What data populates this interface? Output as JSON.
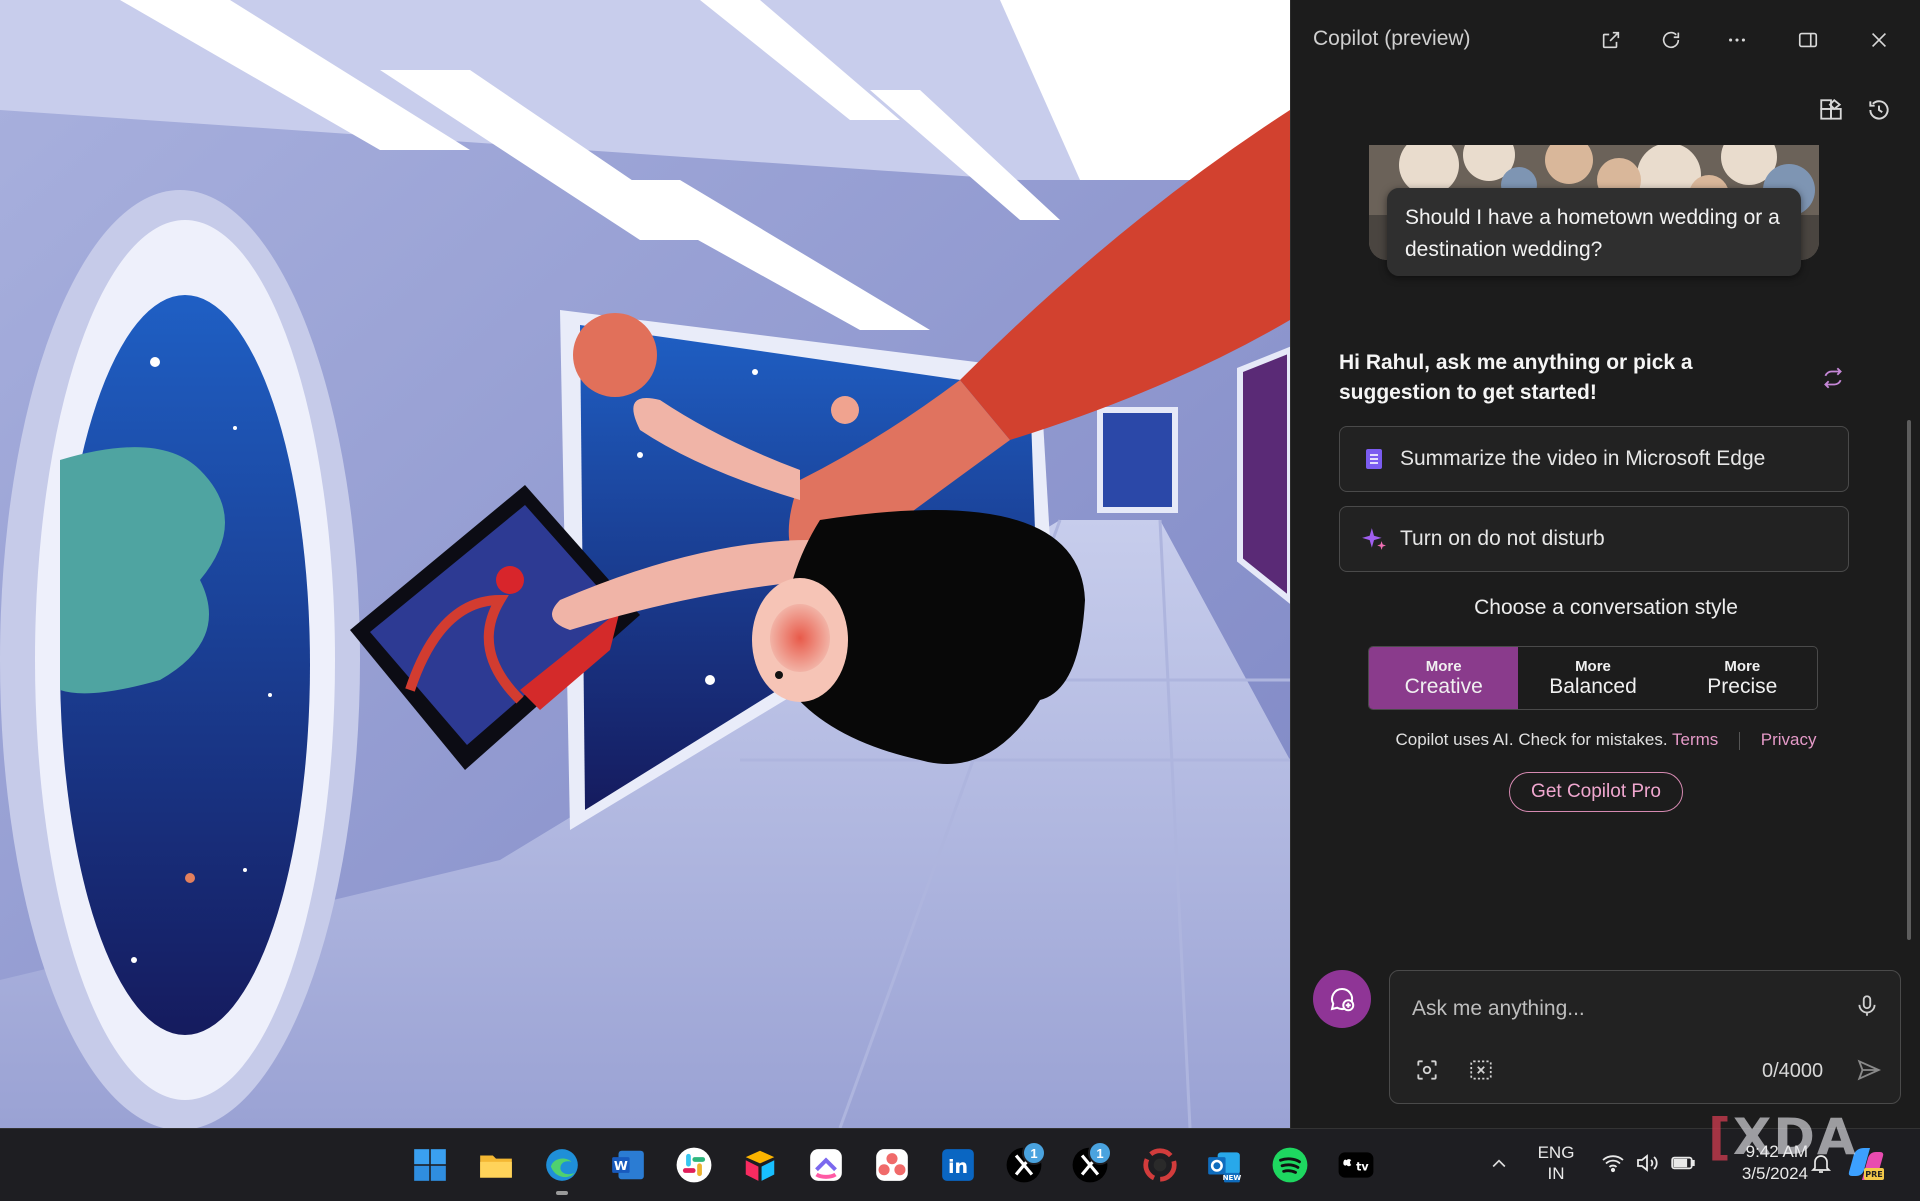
{
  "window": {
    "title": "Copilot (preview)"
  },
  "suggestion_card": {
    "text": "Should I have a hometown wedding or a destination wedding?"
  },
  "greeting": "Hi Rahul, ask me anything or pick a suggestion to get started!",
  "chips": [
    {
      "label": "Summarize the video in Microsoft Edge",
      "icon": "document-list-icon"
    },
    {
      "label": "Turn on do not disturb",
      "icon": "sparkle-icon"
    }
  ],
  "conversation_style": {
    "heading": "Choose a conversation style",
    "options": [
      {
        "small": "More",
        "big": "Creative",
        "active": true
      },
      {
        "small": "More",
        "big": "Balanced",
        "active": false
      },
      {
        "small": "More",
        "big": "Precise",
        "active": false
      }
    ]
  },
  "disclaimer": {
    "text": "Copilot uses AI. Check for mistakes.",
    "terms": "Terms",
    "privacy": "Privacy"
  },
  "pro_button": "Get Copilot Pro",
  "input": {
    "placeholder": "Ask me anything...",
    "value": "",
    "char_count": "0/4000"
  },
  "taskbar": {
    "apps": [
      "start",
      "file-explorer",
      "edge",
      "word",
      "slack",
      "airtable",
      "clickup",
      "asana",
      "linkedin",
      "x",
      "x",
      "screen-recorder",
      "outlook-new",
      "spotify",
      "apple-tv"
    ],
    "x_badges": [
      "1",
      "1"
    ],
    "outlook_badge": "NEW",
    "language": {
      "line1": "ENG",
      "line2": "IN"
    },
    "time": "9:42 AM",
    "date": "3/5/2024",
    "copilot_tray_badge": "PRE"
  },
  "watermark": "XDA",
  "colors": {
    "accent": "#8a3b8c",
    "link": "#e59ac8",
    "panel_bg": "#1c1c1c"
  }
}
